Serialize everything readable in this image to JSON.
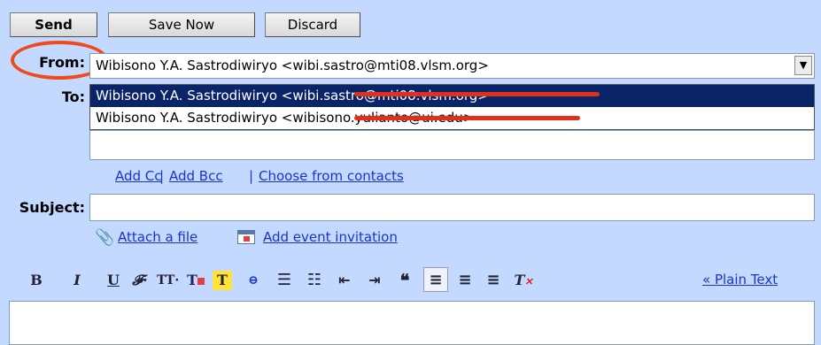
{
  "toolbar": {
    "send": "Send",
    "save_now": "Save Now",
    "discard": "Discard"
  },
  "from": {
    "label": "From:",
    "selected": "Wibisono Y.A. Sastrodiwiryo <wibi.sastro@mti08.vlsm.org>",
    "options": [
      "Wibisono Y.A. Sastrodiwiryo <wibi.sastro@mti08.vlsm.org>",
      "Wibisono Y.A. Sastrodiwiryo <wibisono.yulianto@ui.edu>"
    ]
  },
  "to": {
    "label": "To:",
    "value": ""
  },
  "recipient_links": {
    "add_cc": "Add Cc",
    "add_bcc": "Add Bcc",
    "choose_contacts": "Choose from contacts",
    "separator": "|"
  },
  "subject": {
    "label": "Subject:",
    "value": ""
  },
  "attachments": {
    "attach_file": "Attach a file",
    "add_event": "Add event invitation"
  },
  "format_bar": {
    "plain_text": "« Plain Text"
  },
  "colors": {
    "background": "#c3d9ff",
    "highlight": "#0a246a",
    "link": "#1a33cc",
    "annotation": "#f04a1c"
  }
}
